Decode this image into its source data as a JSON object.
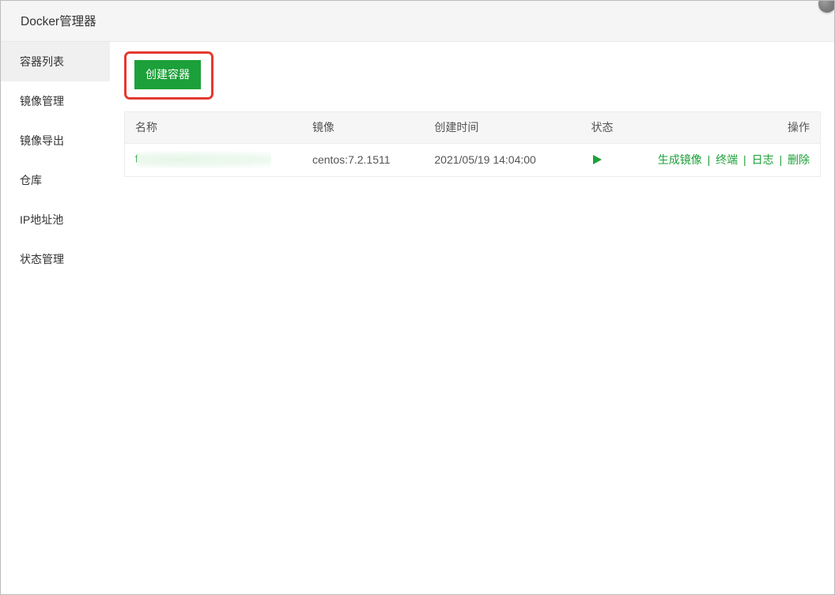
{
  "header": {
    "title": "Docker管理器"
  },
  "sidebar": {
    "items": [
      {
        "label": "容器列表",
        "active": true
      },
      {
        "label": "镜像管理",
        "active": false
      },
      {
        "label": "镜像导出",
        "active": false
      },
      {
        "label": "仓库",
        "active": false
      },
      {
        "label": "IP地址池",
        "active": false
      },
      {
        "label": "状态管理",
        "active": false
      }
    ]
  },
  "toolbar": {
    "create_label": "创建容器"
  },
  "table": {
    "columns": {
      "name": "名称",
      "image": "镜像",
      "create_time": "创建时间",
      "status": "状态",
      "operate": "操作"
    },
    "rows": [
      {
        "name_prefix": "f",
        "image": "centos:7.2.1511",
        "create_time": "2021/05/19 14:04:00",
        "status_icon": "play-icon",
        "actions": {
          "build_image": "生成镜像",
          "terminal": "终端",
          "logs": "日志",
          "delete": "删除"
        }
      }
    ],
    "action_separator": "|"
  },
  "colors": {
    "accent": "#1ca039",
    "highlight_border": "#e43a31"
  }
}
